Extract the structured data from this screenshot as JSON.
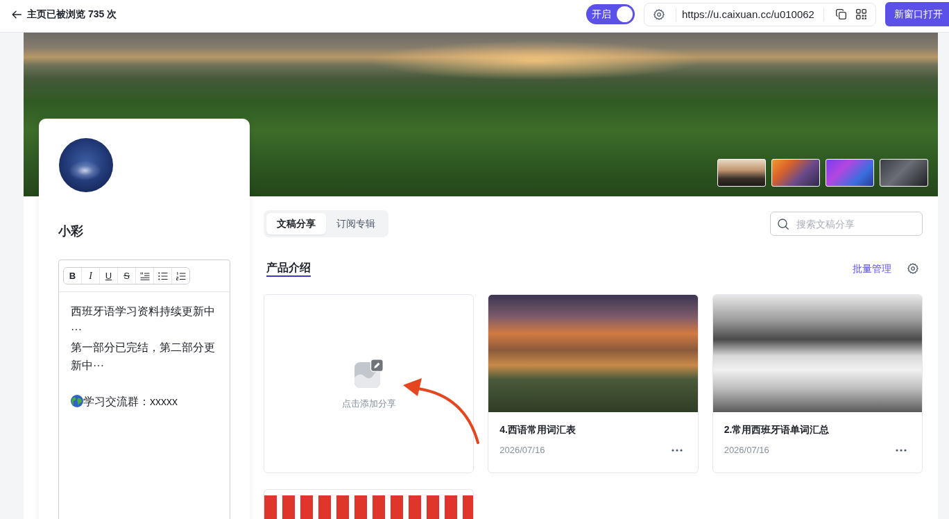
{
  "header": {
    "view_count_text": "主页已被浏览 735 次",
    "toggle": {
      "label": "开启",
      "on": true
    },
    "url": "https://u.caixuan.cc/u010062",
    "open_button": "新窗口打开"
  },
  "profile": {
    "name": "小彩",
    "editor": {
      "toolbar": [
        {
          "kind": "bold",
          "label": "B"
        },
        {
          "kind": "italic",
          "label": "I"
        },
        {
          "kind": "underline",
          "label": "U"
        },
        {
          "kind": "strike",
          "label": "S"
        },
        {
          "kind": "indent"
        },
        {
          "kind": "bullet_list"
        },
        {
          "kind": "numbered_list"
        }
      ],
      "paragraphs": [
        {
          "kind": "text",
          "text": "西班牙语学习资料持续更新中···"
        },
        {
          "kind": "text",
          "text": "第一部分已完结，第二部分更新中···"
        },
        {
          "kind": "blank"
        },
        {
          "kind": "icon_text",
          "text": "学习交流群：xxxxx"
        }
      ]
    }
  },
  "tabs": [
    {
      "label": "文稿分享",
      "selected": true
    },
    {
      "label": "订阅专辑",
      "selected": false
    }
  ],
  "search": {
    "placeholder": "搜索文稿分享"
  },
  "section": {
    "tabs": [
      {
        "label": "产品介绍",
        "selected": true
      }
    ],
    "batch_link": "批量管理"
  },
  "cards": [
    {
      "kind": "add",
      "label": "点击添加分享"
    },
    {
      "kind": "post",
      "title": "4.西语常用词汇表",
      "date": "2026/07/16"
    },
    {
      "kind": "post",
      "title": "2.常用西班牙语单词汇总",
      "date": "2026/07/16"
    },
    {
      "kind": "post"
    }
  ]
}
